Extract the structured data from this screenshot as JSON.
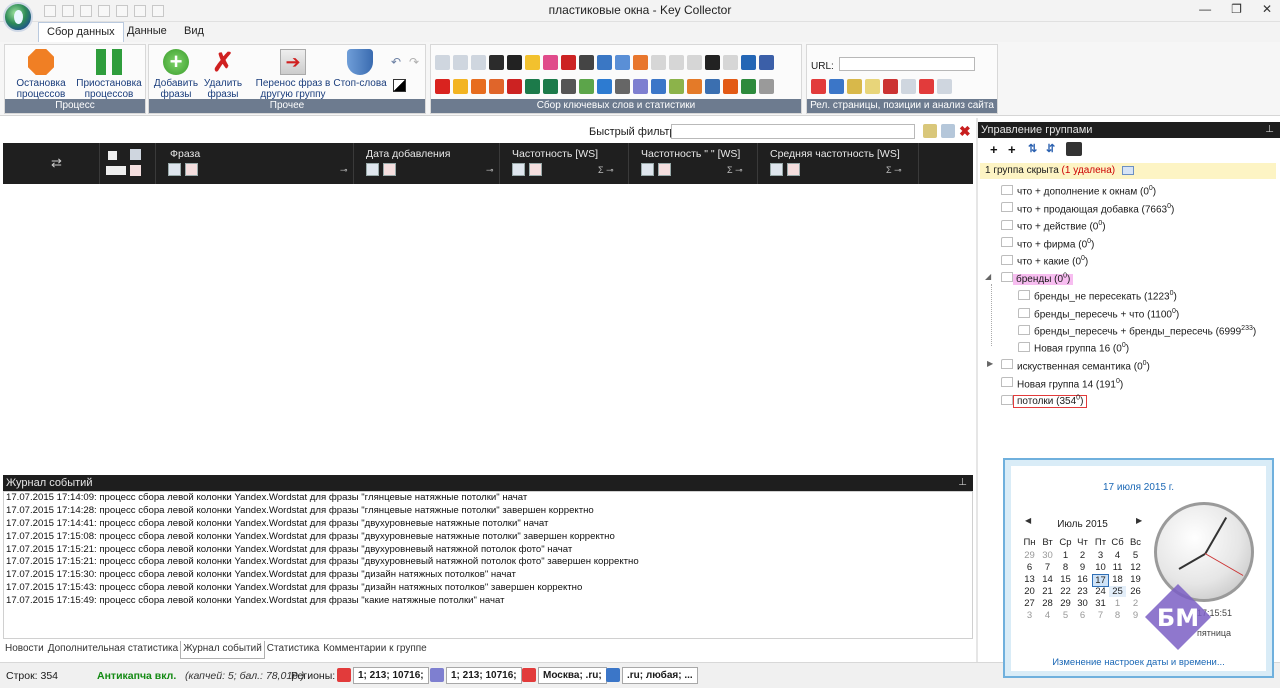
{
  "window": {
    "title": "пластиковые окна - Key Collector",
    "controls": [
      "—",
      "❐",
      "✕"
    ]
  },
  "ribbon_tabs": [
    "Сбор данных",
    "Данные",
    "Вид"
  ],
  "ribbon": {
    "groups": {
      "process": "Процесс",
      "other": "Прочее",
      "keywords": "Сбор ключевых слов и статистики",
      "relevance": "Рел. страницы, позиции и анализ сайта"
    },
    "buttons": {
      "stop": "Остановка процессов",
      "pause": "Приостановка процессов",
      "add": "Добавить фразы",
      "delete": "Удалить фразы",
      "move": "Перенос фраз в другую группу",
      "stopwords": "Стоп-слова"
    },
    "url_label": "URL:",
    "url_value": ""
  },
  "filter": {
    "label": "Быстрый фильтр:",
    "value": ""
  },
  "grid": {
    "columns": [
      "Фраза",
      "Дата добавления",
      "Частотность [WS]",
      "Частотность \" \" [WS]",
      "Средняя частотность [WS]"
    ]
  },
  "log": {
    "title": "Журнал событий",
    "lines": [
      "17.07.2015 17:14:09: процесс сбора левой колонки Yandex.Wordstat для фразы \"глянцевые натяжные потолки\" начат",
      "17.07.2015 17:14:28: процесс сбора левой колонки Yandex.Wordstat для фразы \"глянцевые натяжные потолки\" завершен корректно",
      "17.07.2015 17:14:41: процесс сбора левой колонки Yandex.Wordstat для фразы \"двухуровневые натяжные потолки\" начат",
      "17.07.2015 17:15:08: процесс сбора левой колонки Yandex.Wordstat для фразы \"двухуровневые натяжные потолки\" завершен корректно",
      "17.07.2015 17:15:21: процесс сбора левой колонки Yandex.Wordstat для фразы \"двухуровневый натяжной потолок фото\" начат",
      "17.07.2015 17:15:21: процесс сбора левой колонки Yandex.Wordstat для фразы \"двухуровневый натяжной потолок фото\" завершен корректно",
      "17.07.2015 17:15:30: процесс сбора левой колонки Yandex.Wordstat для фразы \"дизайн натяжных потолков\" начат",
      "17.07.2015 17:15:43: процесс сбора левой колонки Yandex.Wordstat для фразы \"дизайн натяжных потолков\" завершен корректно",
      "17.07.2015 17:15:49: процесс сбора левой колонки Yandex.Wordstat для фразы \"какие натяжные потолки\" начат"
    ]
  },
  "bottom_tabs": [
    "Новости",
    "Дополнительная статистика",
    "Журнал событий",
    "Статистика",
    "Комментарии к группе"
  ],
  "status": {
    "rows": "Строк: 354",
    "anticaptcha": "Антикапча вкл.",
    "anticaptcha_details": "(капчей: 5; бал.: 78,01р.)",
    "regions_label": "Регионы:",
    "region1": "1; 213; 10716;",
    "region2": "1; 213; 10716;",
    "region3": "Москва; .ru;",
    "region4": ".ru; любая; ..."
  },
  "groups_panel": {
    "title": "Управление группами",
    "hidden_text": "1 группа скрыта",
    "hidden_removed": "(1 удалена)",
    "items": [
      {
        "name": "что + дополнение к окнам",
        "count": "0",
        "sup": "0"
      },
      {
        "name": "что + продающая добавка",
        "count": "7663",
        "sup": "0"
      },
      {
        "name": "что + действие",
        "count": "0",
        "sup": "0"
      },
      {
        "name": "что + фирма",
        "count": "0",
        "sup": "0"
      },
      {
        "name": "что + какие",
        "count": "0",
        "sup": "0"
      },
      {
        "name": "бренды",
        "count": "0",
        "sup": "0"
      },
      {
        "name": "бренды_не пересекать",
        "count": "1223",
        "sup": "0"
      },
      {
        "name": "бренды_пересечь + что",
        "count": "1100",
        "sup": "0"
      },
      {
        "name": "бренды_пересечь + бренды_пересечь",
        "count": "6999",
        "sup": "233"
      },
      {
        "name": "Новая группа 16",
        "count": "0",
        "sup": "0"
      },
      {
        "name": "искуственная семантика",
        "count": "0",
        "sup": "0"
      },
      {
        "name": "Новая группа 14",
        "count": "191",
        "sup": "0"
      },
      {
        "name": "потолки",
        "count": "354",
        "sup": "0"
      }
    ]
  },
  "calendar": {
    "full_date": "17 июля 2015 г.",
    "month": "Июль 2015",
    "weekdays": [
      "Пн",
      "Вт",
      "Ср",
      "Чт",
      "Пт",
      "Сб",
      "Вс"
    ],
    "days": [
      "29",
      "30",
      "1",
      "2",
      "3",
      "4",
      "5",
      "6",
      "7",
      "8",
      "9",
      "10",
      "11",
      "12",
      "13",
      "14",
      "15",
      "16",
      "17",
      "18",
      "19",
      "20",
      "21",
      "22",
      "23",
      "24",
      "25",
      "26",
      "27",
      "28",
      "29",
      "30",
      "31",
      "1",
      "2",
      "3",
      "4",
      "5",
      "6",
      "7",
      "8",
      "9"
    ],
    "time": "17:15:51",
    "weekday_name": "пятница",
    "change_link": "Изменение настроек даты и времени..."
  },
  "watermark": "БМ"
}
